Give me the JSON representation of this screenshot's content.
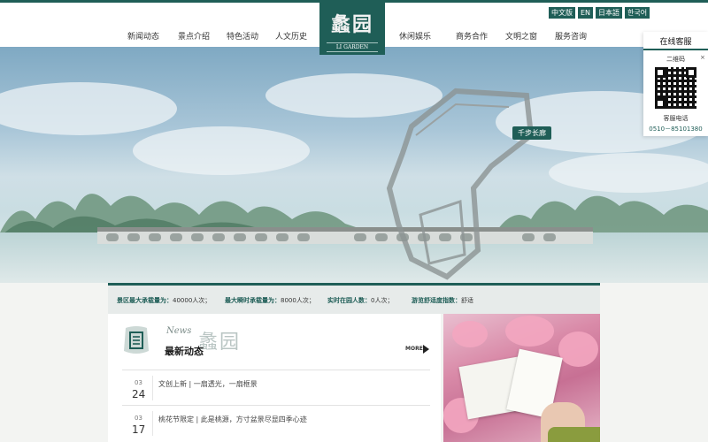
{
  "nav": {
    "left": [
      "新闻动态",
      "景点介绍",
      "特色活动",
      "人文历史"
    ],
    "right": [
      "休闲娱乐",
      "商务合作",
      "文明之窗",
      "服务咨询"
    ]
  },
  "logo": {
    "main": "蠡园",
    "sub": "LI GARDEN"
  },
  "languages": [
    "中文版",
    "EN",
    "日本語",
    "한국어"
  ],
  "hero": {
    "map_label": "千步长廊"
  },
  "stats": [
    {
      "label": "景区最大承载量为：",
      "value": "40000人次；"
    },
    {
      "label": "最大瞬时承载量为：",
      "value": "8000人次；"
    },
    {
      "label": "实时在园人数：",
      "value": "0人次；"
    },
    {
      "label": "游览舒适度指数：",
      "value": "舒适"
    }
  ],
  "news": {
    "en": "News",
    "deco": "蠡园",
    "title": "最新动态",
    "more": "MORE",
    "items": [
      {
        "month": "03",
        "day": "24",
        "text": "文创上新 | 一扇透光，一扇框景"
      },
      {
        "month": "03",
        "day": "17",
        "text": "桃花节限定 | 此是桃源，方寸盆景尽显四季心迹"
      }
    ]
  },
  "service": {
    "title": "在线客服",
    "qr_label": "二维码",
    "close": "×",
    "phone_label": "客服电话",
    "phone": "0510－85101380"
  },
  "colors": {
    "brand": "#1f5e57",
    "background": "#f3f4f2"
  }
}
